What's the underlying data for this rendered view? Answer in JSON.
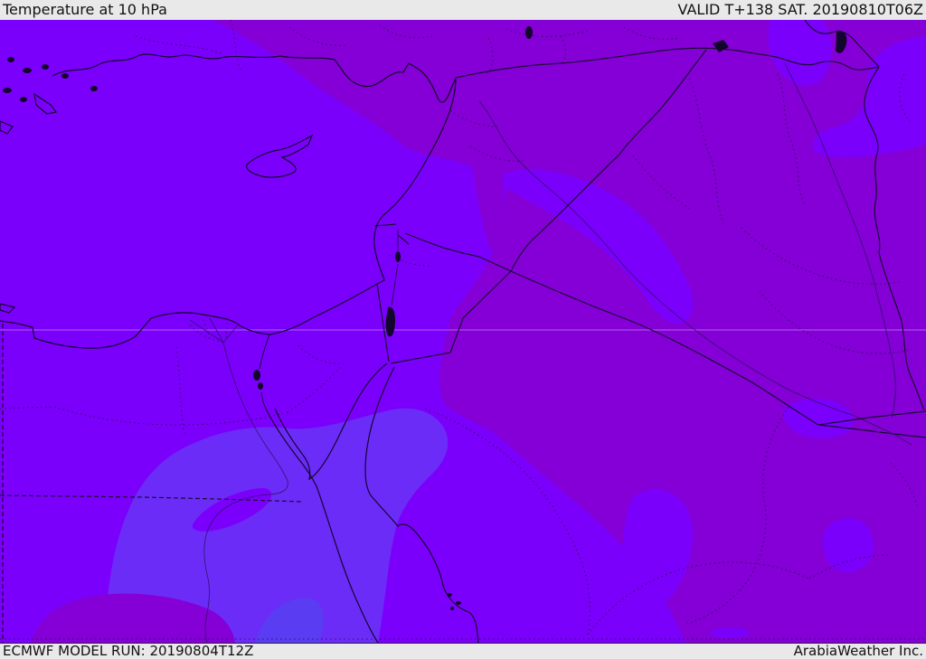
{
  "header": {
    "title": "Temperature at 10 hPa",
    "valid_time": "VALID T+138 SAT. 20190810T06Z"
  },
  "footer": {
    "model_run": "ECMWF MODEL RUN: 20190804T12Z",
    "brand": "ArabiaWeather Inc."
  },
  "map": {
    "kind": "temperature contour fill map, Middle East / Eastern Mediterranean",
    "palette": {
      "bar_bg": "#e9e9e9",
      "band_dark": "#8400D6",
      "band_violet": "#7B00FB",
      "band_light": "#6B2CF8",
      "band_blue": "#5A3CF3",
      "coast": "#14052d",
      "border_solid": "#1a0b33",
      "border_dotted": "#26104a",
      "river": "#2a1060",
      "gridline": "#d9b3ff"
    }
  }
}
